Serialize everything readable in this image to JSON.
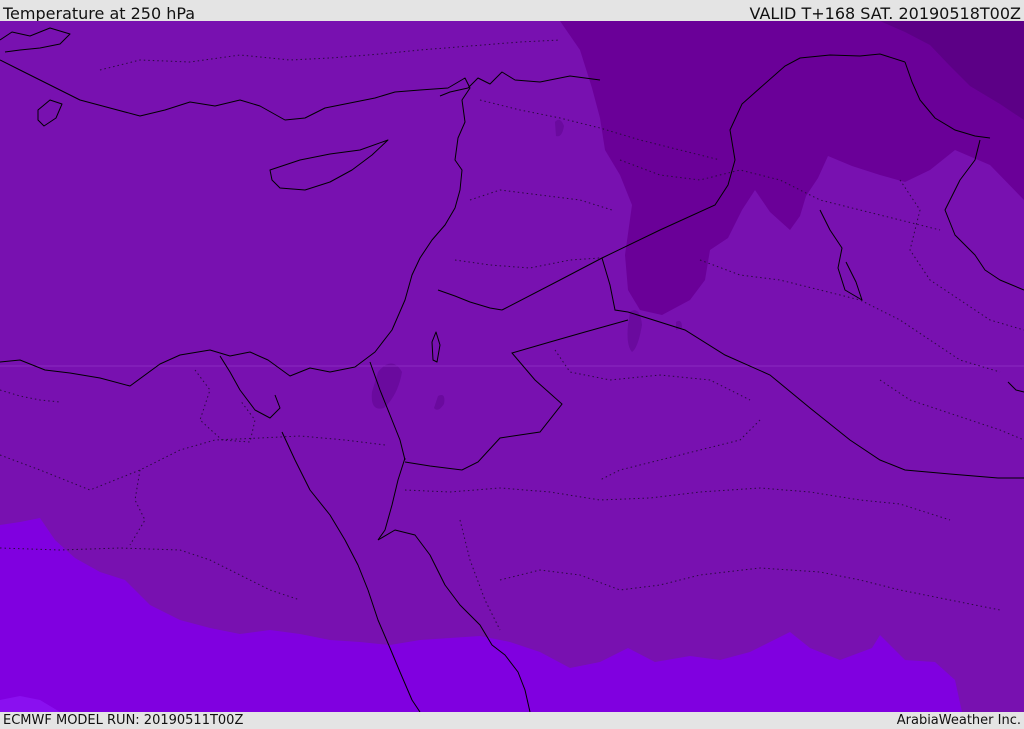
{
  "header": {
    "title": "Temperature at 250 hPa",
    "valid": "VALID T+168 SAT. 20190518T00Z"
  },
  "footer": {
    "model_run": "ECMWF MODEL RUN: 20190511T00Z",
    "credit": "ArabiaWeather Inc."
  },
  "colors": {
    "field_base": "#7811b0",
    "field_cold": "#6a0098",
    "field_coldest": "#5c0086",
    "field_warm": "#8000e0",
    "field_warmest": "#8a10f0",
    "small_cold_patch": "#6a0a9e",
    "bar_background": "#e4e4e4"
  }
}
